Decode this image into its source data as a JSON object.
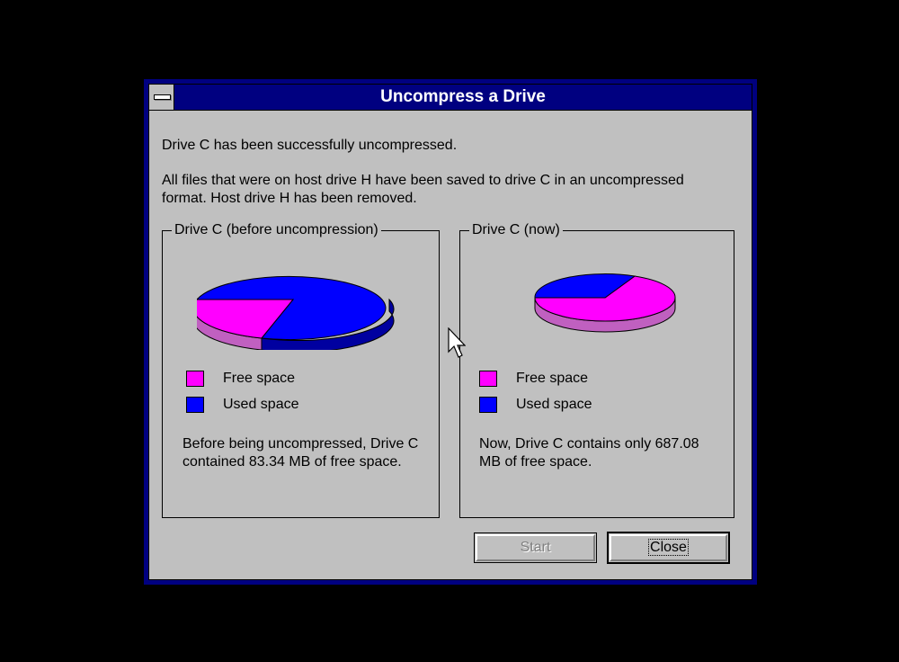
{
  "dialog": {
    "title": "Uncompress a Drive",
    "message_line1": "Drive C has been successfully uncompressed.",
    "message_line2": "All files that were on host drive H have been saved to drive C in an uncompressed",
    "message_line3": "format. Host drive H has been removed."
  },
  "before": {
    "label": "Drive C (before uncompression)",
    "legend_free": "Free space",
    "legend_used": "Used space",
    "desc_line1": "Before being uncompressed, Drive C",
    "desc_line2": "contained 83.34 MB of free space.",
    "free_fraction": 0.25
  },
  "now": {
    "label": "Drive C (now)",
    "legend_free": "Free space",
    "legend_used": "Used space",
    "desc_line1": "Now, Drive C contains only 687.08",
    "desc_line2": "MB of free space.",
    "free_fraction": 0.6
  },
  "buttons": {
    "start": "Start",
    "close": "Close"
  },
  "colors": {
    "free": "#ff00ff",
    "free_side": "#c060c0",
    "used": "#0000ff",
    "used_side": "#0000a0",
    "titlebar": "#000080",
    "face": "#c0c0c0"
  }
}
